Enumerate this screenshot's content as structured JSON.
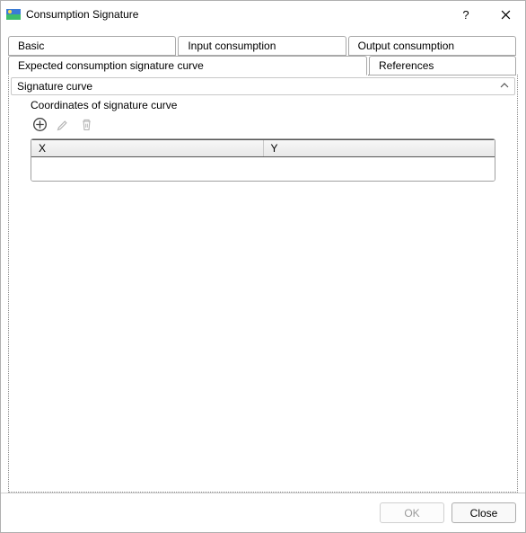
{
  "window": {
    "title": "Consumption Signature"
  },
  "tabs": {
    "row1": [
      {
        "label": "Basic"
      },
      {
        "label": "Input consumption"
      },
      {
        "label": "Output consumption"
      }
    ],
    "row2": [
      {
        "label": "Expected consumption signature curve",
        "selected": true
      },
      {
        "label": "References"
      }
    ]
  },
  "accordion": {
    "title": "Signature curve",
    "expanded": true
  },
  "section": {
    "label": "Coordinates of signature curve"
  },
  "toolbar": {
    "add": "add",
    "edit": "edit",
    "delete": "delete"
  },
  "table": {
    "columns": [
      "X",
      "Y"
    ],
    "rows": []
  },
  "buttons": {
    "ok": "OK",
    "close": "Close"
  }
}
